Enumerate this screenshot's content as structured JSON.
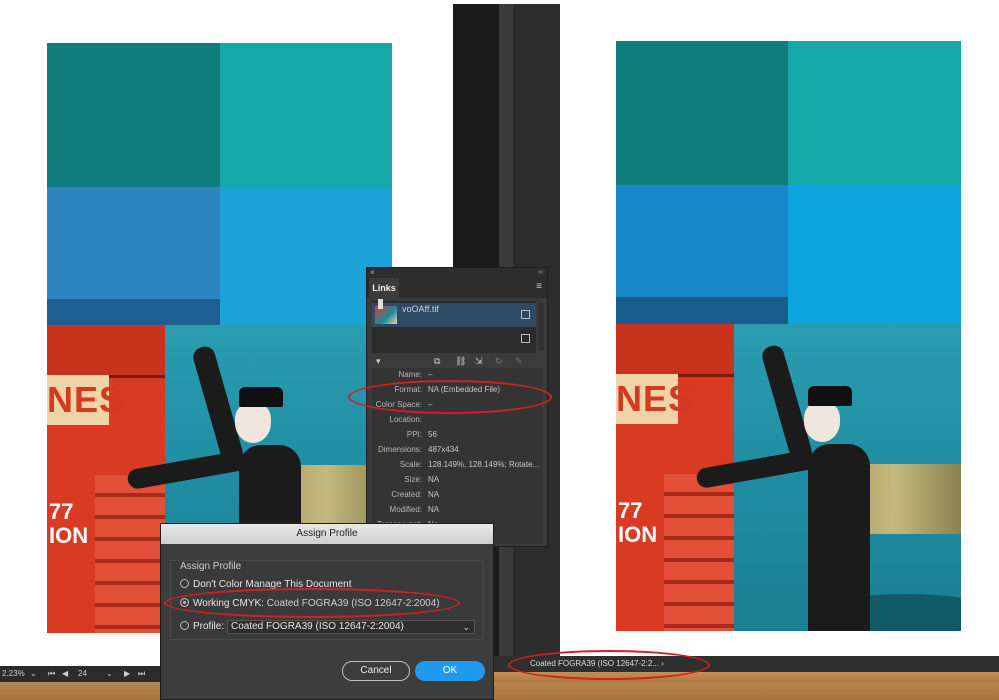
{
  "links_panel": {
    "close_glyph": "×",
    "collapse_glyph": "‹‹",
    "tab_label": "Links",
    "menu_glyph": "≡",
    "file_name": "voOAff.tif",
    "info": [
      {
        "label": "Name:",
        "value": "–"
      },
      {
        "label": "Format:",
        "value": "NA (Embedded File)"
      },
      {
        "label": "Color Space:",
        "value": "–"
      },
      {
        "label": "Location:",
        "value": ""
      },
      {
        "label": "PPI:",
        "value": "56"
      },
      {
        "label": "Dimensions:",
        "value": "487x434"
      },
      {
        "label": "Scale:",
        "value": "128.149%, 128.149%; Rotate..."
      },
      {
        "label": "Size:",
        "value": "NA"
      },
      {
        "label": "Created:",
        "value": "NA"
      },
      {
        "label": "Modified:",
        "value": "NA"
      },
      {
        "label": "Transparent:",
        "value": "No"
      }
    ]
  },
  "assign_profile": {
    "title": "Assign Profile",
    "group_title": "Assign Profile",
    "option_dont_manage": "Don't Color Manage This Document",
    "option_working_label": "Working CMYK:",
    "option_working_value": "Coated FOGRA39 (ISO 12647-2:2004)",
    "option_profile_label": "Profile:",
    "profile_select_value": "Coated FOGRA39 (ISO 12647-2:2004)",
    "cancel_label": "Cancel",
    "ok_label": "OK"
  },
  "status_bar_left": {
    "zoom": "2.23%",
    "page": "24"
  },
  "status_bar_right": {
    "profile": "Coated FOGRA39 (ISO 12647-2:2... ›"
  },
  "artwork": {
    "sign_text": "NES",
    "bus_number": "77",
    "bus_number_line2": "ION"
  },
  "colors": {
    "swatch_teal_dark": "#0f7d7c",
    "swatch_teal_light": "#16a7a8",
    "swatch_blue_left": "#2e86c1",
    "swatch_cyan_left": "#1ba3d8",
    "swatch_navy_left": "#1f5f94",
    "swatch_blue_right": "#1587c8",
    "swatch_cyan_right": "#0ea5df",
    "swatch_navy_right": "#1a5c8c",
    "annotation_red": "#d42020",
    "ok_blue": "#1f9af0"
  }
}
